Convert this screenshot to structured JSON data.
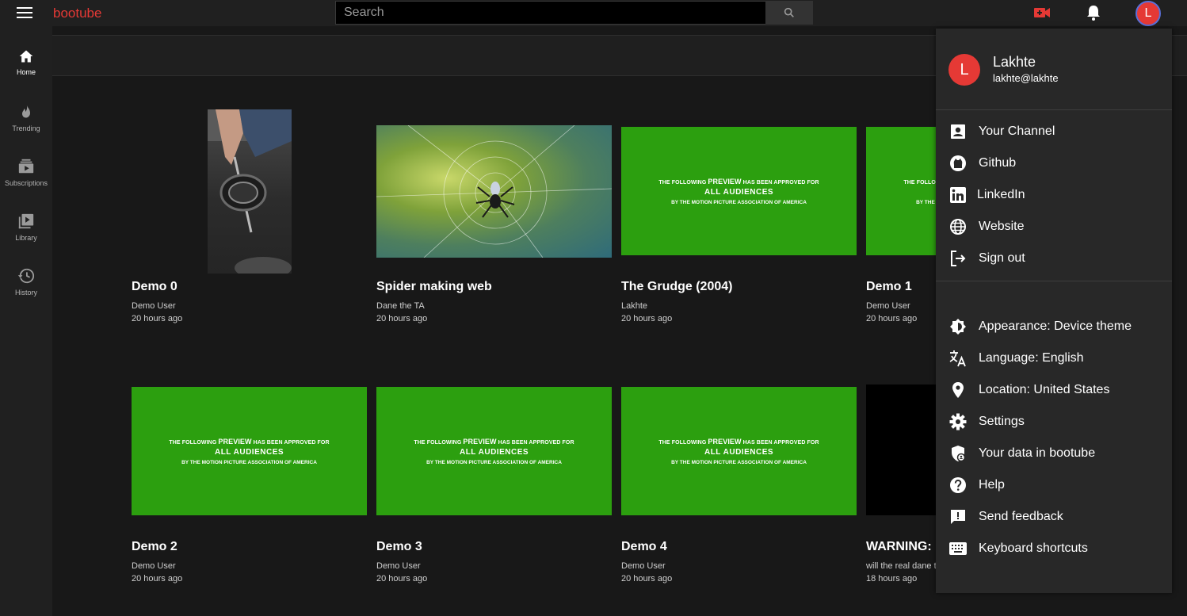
{
  "app": {
    "logo": "bootube"
  },
  "search": {
    "placeholder": "Search"
  },
  "topbar": {
    "create_icon": "video-camera-plus-icon",
    "notify_icon": "bell-icon",
    "avatar_letter": "L"
  },
  "sidebar": {
    "items": [
      {
        "label": "Home",
        "icon": "home-icon",
        "active": true
      },
      {
        "label": "Trending",
        "icon": "fire-icon",
        "active": false
      },
      {
        "label": "Subscriptions",
        "icon": "subscriptions-icon",
        "active": false
      },
      {
        "label": "Library",
        "icon": "library-icon",
        "active": false
      },
      {
        "label": "History",
        "icon": "history-icon",
        "active": false
      }
    ]
  },
  "preview_card": {
    "line1_pre": "THE FOLLOWING ",
    "line1_bold": "PREVIEW",
    "line1_post": " HAS BEEN APPROVED FOR",
    "line2": "ALL AUDIENCES",
    "line3": "BY THE MOTION PICTURE ASSOCIATION OF AMERICA"
  },
  "videos": [
    {
      "title": "Demo 0",
      "channel": "Demo User",
      "time": "20 hours ago",
      "thumb": "gym"
    },
    {
      "title": "Spider making web",
      "channel": "Dane the TA",
      "time": "20 hours ago",
      "thumb": "spider"
    },
    {
      "title": "The Grudge (2004)",
      "channel": "Lakhte",
      "time": "20 hours ago",
      "thumb": "green"
    },
    {
      "title": "Demo 1",
      "channel": "Demo User",
      "time": "20 hours ago",
      "thumb": "green"
    },
    {
      "title": "Demo 2",
      "channel": "Demo User",
      "time": "20 hours ago",
      "thumb": "green"
    },
    {
      "title": "Demo 3",
      "channel": "Demo User",
      "time": "20 hours ago",
      "thumb": "green"
    },
    {
      "title": "Demo 4",
      "channel": "Demo User",
      "time": "20 hours ago",
      "thumb": "green"
    },
    {
      "title": "WARNING: DO NOT CLICK",
      "channel": "will the real dane tes spool up",
      "time": "18 hours ago",
      "thumb": "black"
    }
  ],
  "menu": {
    "avatar_letter": "L",
    "name": "Lakhte",
    "email": "lakhte@lakhte",
    "section1": [
      {
        "label": "Your Channel",
        "icon": "account-box-icon"
      },
      {
        "label": "Github",
        "icon": "github-icon"
      },
      {
        "label": "LinkedIn",
        "icon": "linkedin-icon"
      },
      {
        "label": "Website",
        "icon": "globe-icon"
      },
      {
        "label": "Sign out",
        "icon": "sign-out-icon"
      }
    ],
    "section2": [
      {
        "label": "Appearance: Device theme",
        "icon": "theme-icon"
      },
      {
        "label": "Language: English",
        "icon": "translate-icon"
      },
      {
        "label": "Location: United States",
        "icon": "location-pin-icon"
      },
      {
        "label": "Settings",
        "icon": "gear-icon"
      },
      {
        "label": "Your data in bootube",
        "icon": "shield-person-icon"
      },
      {
        "label": "Help",
        "icon": "help-icon"
      },
      {
        "label": "Send feedback",
        "icon": "feedback-icon"
      },
      {
        "label": "Keyboard shortcuts",
        "icon": "keyboard-icon"
      }
    ]
  },
  "colors": {
    "brand": "#e53935",
    "preview_green": "#2c9f0f",
    "background": "#181818",
    "surface": "#202020",
    "menu": "#282828"
  }
}
